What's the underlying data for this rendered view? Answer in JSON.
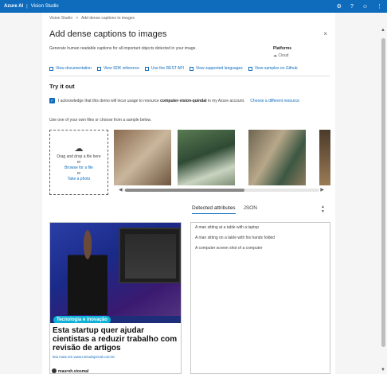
{
  "topbar": {
    "brand": "Azure AI",
    "separator": "|",
    "app": "Vision Studio",
    "icons": [
      "gear-icon",
      "help-icon",
      "smiley-icon",
      "more-icon"
    ]
  },
  "breadcrumb": {
    "root": "Vision Studio",
    "chevron": ">",
    "current": "Add dense captions to images"
  },
  "page": {
    "title": "Add dense captions to images",
    "description": "Generate human readable captions for all important objects detected in your image.",
    "close_glyph": "×"
  },
  "platforms": {
    "label": "Platforms",
    "value": "Cloud"
  },
  "links": [
    {
      "label": "View documentation"
    },
    {
      "label": "View SDK reference"
    },
    {
      "label": "Use the REST API"
    },
    {
      "label": "View supported languages"
    },
    {
      "label": "View samples on Github"
    }
  ],
  "tryit": {
    "heading": "Try it out",
    "ack_text": "I acknowledge that this demo will incur usage to resource",
    "resource_name": "computer-vision-quindal",
    "ack_suffix": "in my Azure account.",
    "change_link": "Choose a different resource",
    "choose_text": "Use one of your own files or choose from a sample below."
  },
  "dropzone": {
    "line1": "Drag and drop a file here",
    "line2": "or",
    "browse": "Browse for a file",
    "line3": "or",
    "photo": "Take a photo"
  },
  "tabs": {
    "detected": "Detected attributes",
    "json": "JSON"
  },
  "image": {
    "badge": "Tecnologia e inovação",
    "headline": "Esta startup quer ajudar cientistas a reduzir trabalho com revisão de artigos",
    "source": "leia mais em www.meiodojornal.com.br",
    "author": "mauroh.viosmal"
  },
  "captions": [
    "A man sitting at a table with a laptop",
    "A man sitting on a table with his hands folded",
    "A computer screen shot of a computer"
  ],
  "colors": {
    "accent": "#0f6cbd",
    "badge": "#0fb2d6"
  }
}
